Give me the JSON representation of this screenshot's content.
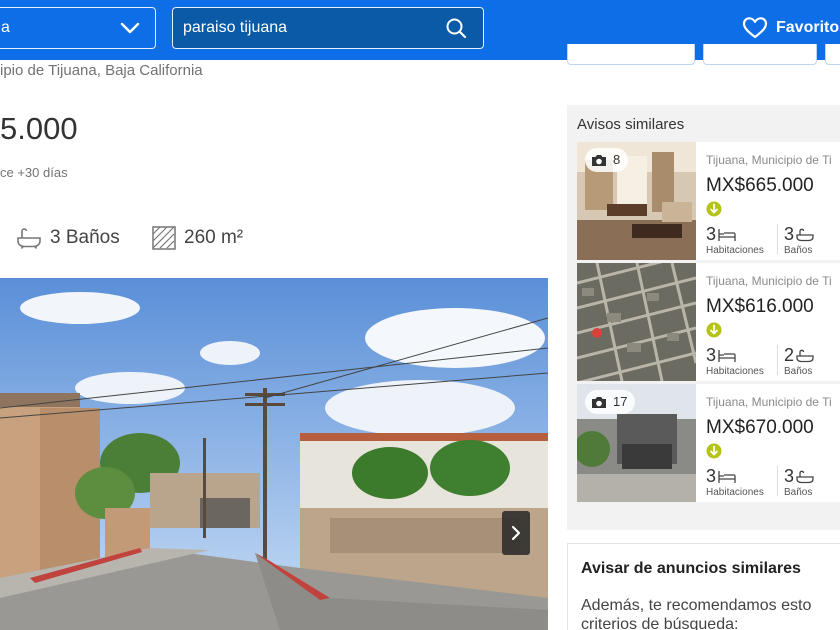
{
  "header": {
    "category_value": "a",
    "search_value": "paraiso tijuana",
    "favorites_label": "Favoritos"
  },
  "listing": {
    "location": "ipio de Tijuana, Baja California",
    "price": "5.000",
    "published": "ce +30 días",
    "baths": "3 Baños",
    "area": "260 m²"
  },
  "similar": {
    "title": "Avisos similares",
    "items": [
      {
        "photo_count": "8",
        "location": "Tijuana, Municipio de Ti",
        "price": "MX$665.000",
        "rooms": "3",
        "rooms_label": "Habitaciones",
        "baths": "3",
        "baths_label": "Baños"
      },
      {
        "photo_count": "",
        "location": "Tijuana, Municipio de Ti",
        "price": "MX$616.000",
        "rooms": "3",
        "rooms_label": "Habitaciones",
        "baths": "2",
        "baths_label": "Baños"
      },
      {
        "photo_count": "17",
        "location": "Tijuana, Municipio de Ti",
        "price": "MX$670.000",
        "rooms": "3",
        "rooms_label": "Habitaciones",
        "baths": "3",
        "baths_label": "Baños"
      }
    ]
  },
  "alert": {
    "title": "Avisar de anuncios similares",
    "text": "Además, te recomendamos esto criterios de búsqueda:"
  },
  "colors": {
    "header_blue": "#0e6ee8",
    "price_down_green": "#b5c218"
  }
}
